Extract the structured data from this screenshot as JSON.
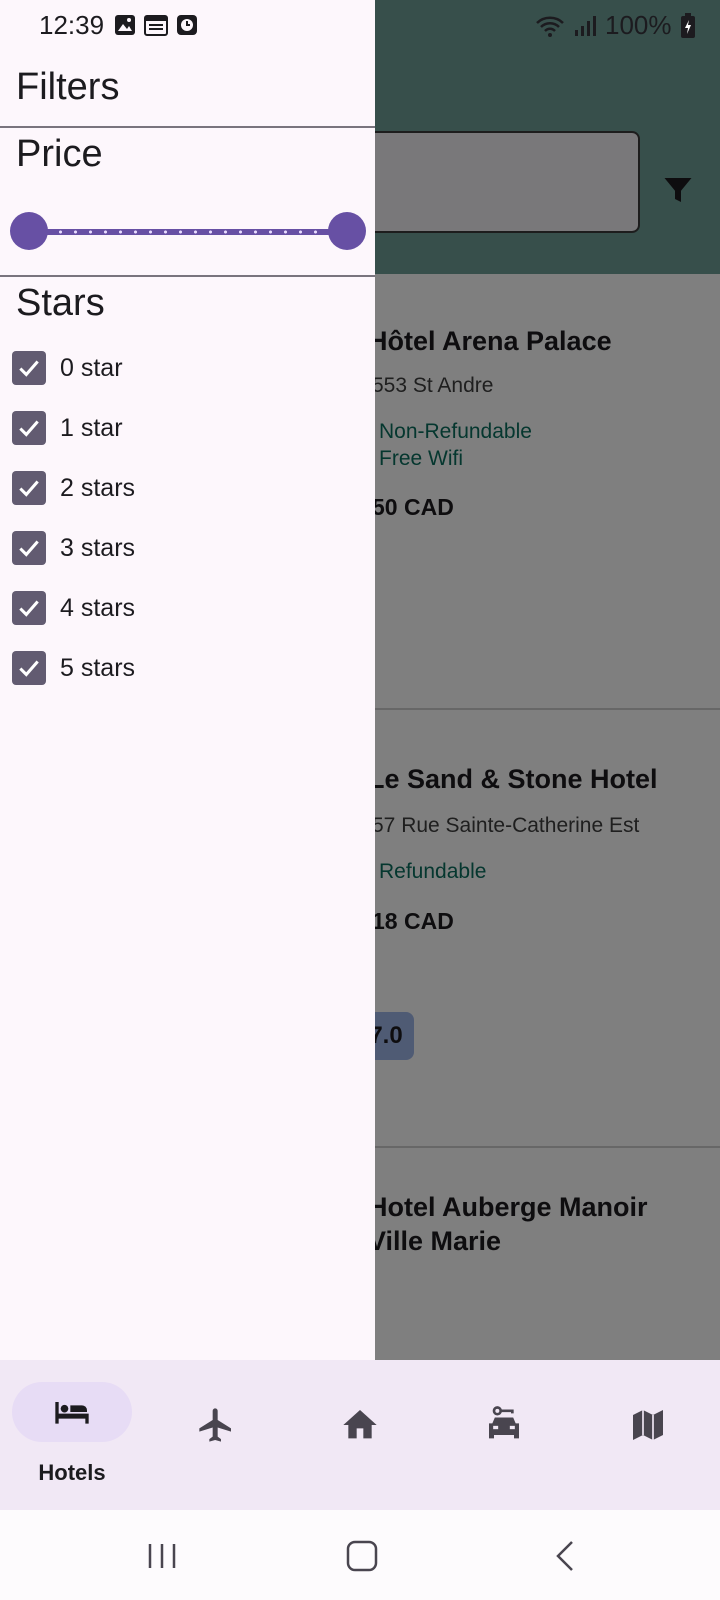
{
  "status_bar": {
    "time": "12:39",
    "battery": "100%",
    "left_icons": [
      "image-icon",
      "calendar-icon",
      "clock-icon"
    ],
    "right_icons": [
      "wifi-icon",
      "signal-icon",
      "battery-charging-icon"
    ]
  },
  "drawer": {
    "title": "Filters",
    "price": {
      "title": "Price",
      "min_fraction": 0.0,
      "max_fraction": 1.0
    },
    "stars": {
      "title": "Stars",
      "options": [
        {
          "label": "0 star",
          "checked": true
        },
        {
          "label": "1 star",
          "checked": true
        },
        {
          "label": "2 stars",
          "checked": true
        },
        {
          "label": "3 stars",
          "checked": true
        },
        {
          "label": "4 stars",
          "checked": true
        },
        {
          "label": "5 stars",
          "checked": true
        }
      ]
    }
  },
  "hotels": [
    {
      "name": "Hôtel Arena Palace",
      "address": "553 St Andre",
      "tags": [
        "Non-Refundable",
        "Free Wifi"
      ],
      "price": "50 CAD"
    },
    {
      "name": "Le Sand & Stone Hotel",
      "address": "57 Rue Sainte-Catherine Est",
      "tags": [
        "Refundable"
      ],
      "price": "18 CAD"
    },
    {
      "name": "Hotel Auberge Manoir Ville Marie",
      "name_line1": "Hotel Auberge Manoir",
      "name_line2": "Ville Marie",
      "rating": "7.0"
    }
  ],
  "bottom_nav": {
    "items": [
      {
        "icon": "bed-icon",
        "label": "Hotels",
        "active": true
      },
      {
        "icon": "airplane-icon",
        "label": "",
        "active": false
      },
      {
        "icon": "home-icon",
        "label": "",
        "active": false
      },
      {
        "icon": "car-rental-icon",
        "label": "",
        "active": false
      },
      {
        "icon": "map-icon",
        "label": "",
        "active": false
      }
    ]
  },
  "colors": {
    "accent": "#6750a4",
    "checkbox": "#625b71",
    "app_bar": "#6f9e96",
    "tag_green": "#0b6e5e",
    "nav_bg": "#f1e8f5",
    "drawer_bg": "#fdf7fc"
  }
}
